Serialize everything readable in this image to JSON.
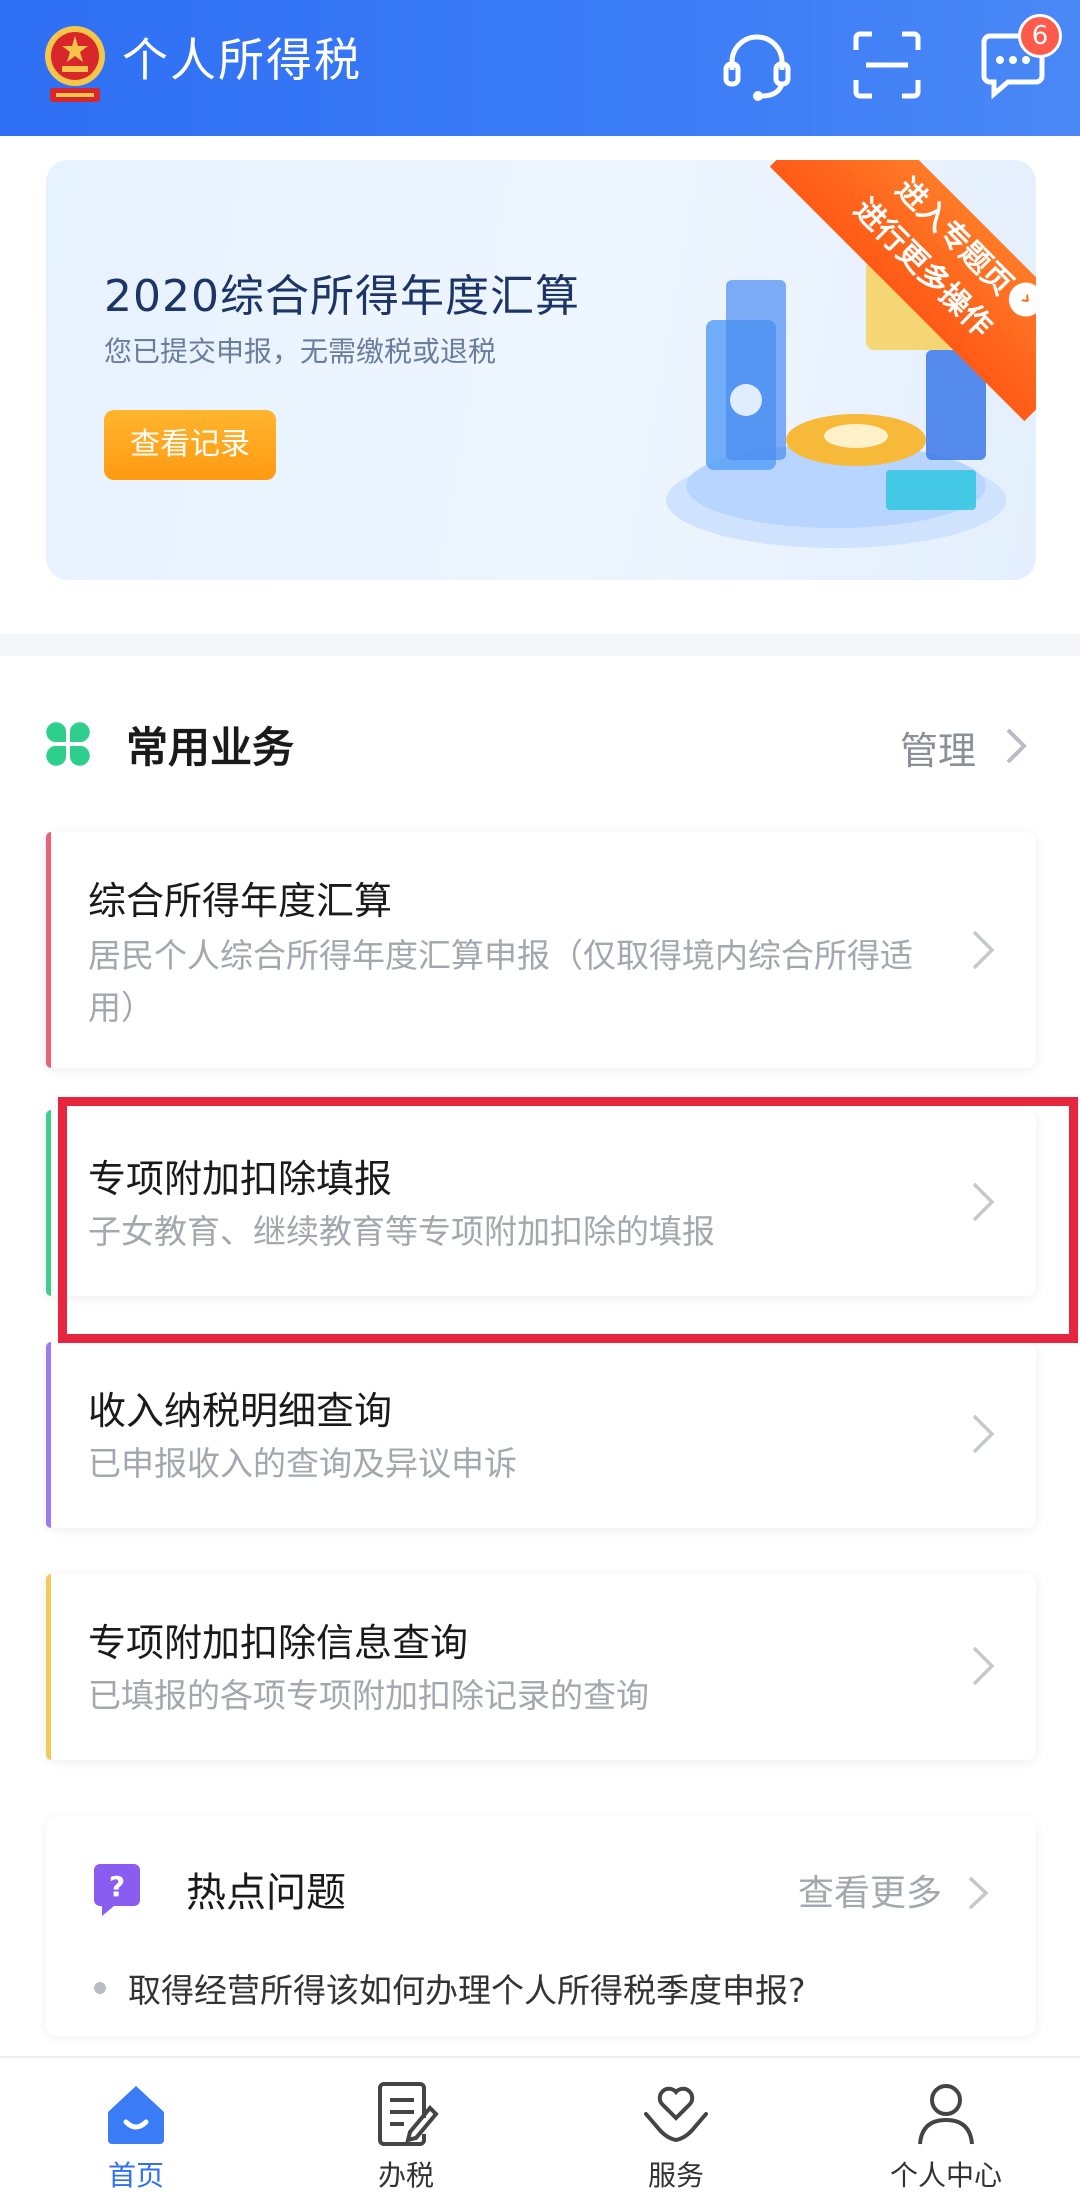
{
  "header": {
    "title": "个人所得税",
    "message_badge": "6",
    "icons": [
      "emblem-icon",
      "customer-service-icon",
      "scan-icon",
      "message-icon"
    ]
  },
  "banner": {
    "title": "2020综合所得年度汇算",
    "subtitle": "您已提交申报，无需缴税或退税",
    "button": "查看记录",
    "ribbon_line1": "进入专题页",
    "ribbon_line2": "进行更多操作"
  },
  "section": {
    "title": "常用业务",
    "manage": "管理"
  },
  "cards": [
    {
      "title": "综合所得年度汇算",
      "desc": "居民个人综合所得年度汇算申报（仅取得境内综合所得适用）",
      "accent": "#f0607a"
    },
    {
      "title": "专项附加扣除填报",
      "desc": "子女教育、继续教育等专项附加扣除的填报",
      "accent": "#3ccf8e"
    },
    {
      "title": "收入纳税明细查询",
      "desc": "已申报收入的查询及异议申诉",
      "accent": "#9b7cf2"
    },
    {
      "title": "专项附加扣除信息查询",
      "desc": "已填报的各项专项附加扣除记录的查询",
      "accent": "#f5c85a"
    }
  ],
  "hot": {
    "title": "热点问题",
    "more": "查看更多",
    "items": [
      "取得经营所得该如何办理个人所得税季度申报?"
    ]
  },
  "nav": [
    {
      "label": "首页",
      "active": true
    },
    {
      "label": "办税",
      "active": false
    },
    {
      "label": "服务",
      "active": false
    },
    {
      "label": "个人中心",
      "active": false
    }
  ],
  "colors": {
    "primary": "#2f6ff4",
    "highlight_border": "#e8253e",
    "orange": "#ff9a12"
  }
}
